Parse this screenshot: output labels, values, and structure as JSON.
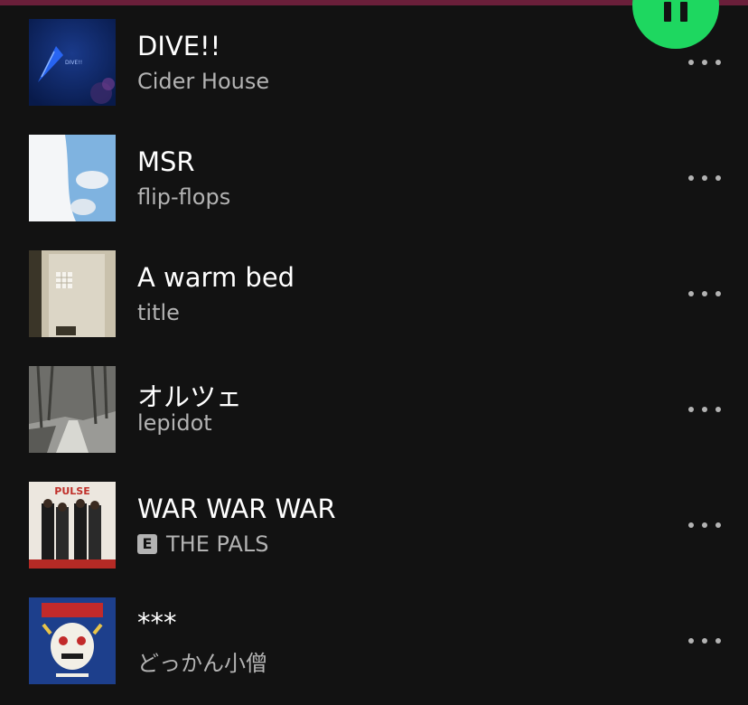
{
  "tracks": [
    {
      "title": "DIVE!!",
      "artist": "Cider House",
      "explicit": false,
      "art_icon": "album-art-dive"
    },
    {
      "title": "MSR",
      "artist": "flip-flops",
      "explicit": false,
      "art_icon": "album-art-msr"
    },
    {
      "title": "A warm bed",
      "artist": "title",
      "explicit": false,
      "art_icon": "album-art-warm-bed"
    },
    {
      "title": "オルツェ",
      "artist": "lepidot",
      "explicit": false,
      "art_icon": "album-art-forest"
    },
    {
      "title": "WAR WAR WAR",
      "artist": "THE PALS",
      "explicit": true,
      "explicit_label": "E",
      "art_icon": "album-art-pulse"
    },
    {
      "title": "***",
      "artist": "どっかん小僧",
      "explicit": false,
      "art_icon": "album-art-mask"
    }
  ],
  "art_text": {
    "dive": "DIVE!!",
    "pulse": "PULSE"
  },
  "colors": {
    "background": "#121212",
    "accent_bar": "#6a1f3a",
    "play_button": "#1ed760",
    "primary_text": "#ffffff",
    "secondary_text": "#b3b3b3"
  },
  "play_button_icon": "pause-icon",
  "more_icon": "more-options-icon"
}
